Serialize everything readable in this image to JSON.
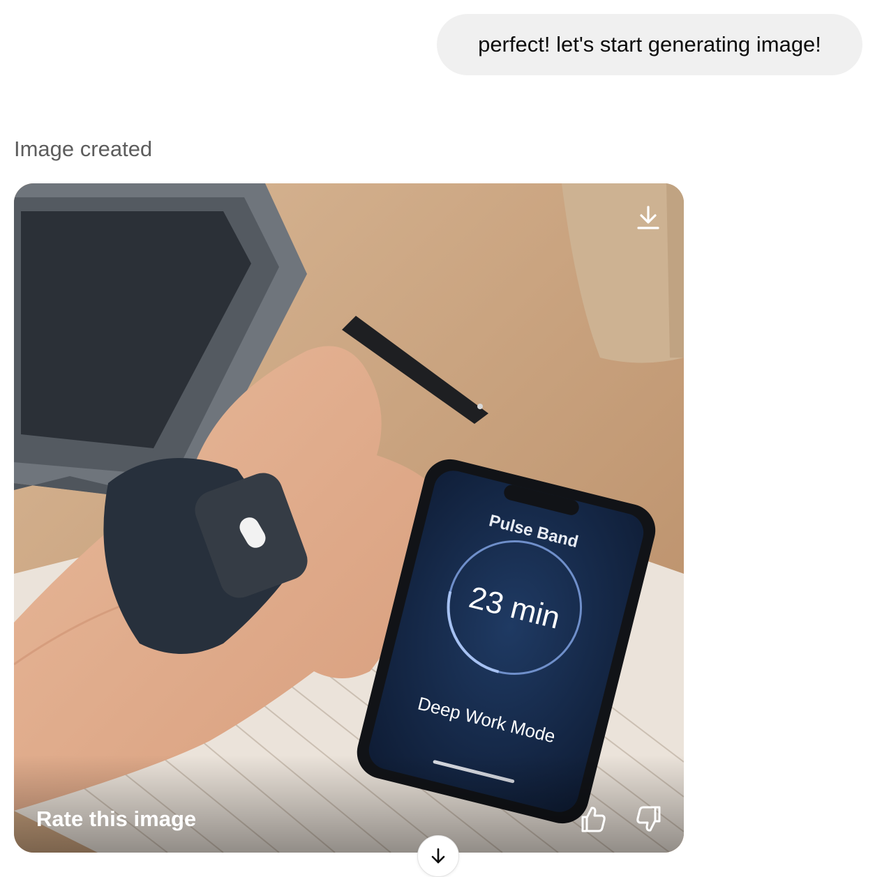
{
  "conversation": {
    "user_message": "perfect! let's start generating image!",
    "assistant_status": "Image created"
  },
  "image": {
    "app_name": "Pulse Band",
    "timer_value": "23 min",
    "mode_label": "Deep Work Mode",
    "download_icon": "download-icon",
    "rate_label": "Rate this image",
    "thumbs_up_icon": "thumbs-up-icon",
    "thumbs_down_icon": "thumbs-down-icon"
  },
  "controls": {
    "scroll_icon": "arrow-down-icon"
  }
}
